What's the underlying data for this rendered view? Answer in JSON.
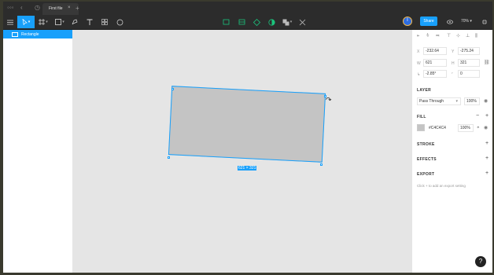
{
  "window": {
    "tab_title": "First file",
    "tab_close": "×",
    "new_tab": "+"
  },
  "toolbar": {
    "share_label": "Share",
    "zoom_label": "70%",
    "avatar_initial": "I"
  },
  "layers": {
    "items": [
      {
        "label": "Rectangle"
      }
    ]
  },
  "canvas": {
    "selection_size_label": "621 × 321"
  },
  "design": {
    "x": {
      "label": "X",
      "value": "-232.64"
    },
    "y": {
      "label": "Y",
      "value": "-275.24"
    },
    "w": {
      "label": "W",
      "value": "621"
    },
    "h": {
      "label": "H",
      "value": "321"
    },
    "rotation": {
      "label": "↳",
      "value": "-2.85°"
    },
    "radius": {
      "label": "⌜",
      "value": "0"
    }
  },
  "layer_section": {
    "title": "LAYER",
    "blend_mode": "Pass Through",
    "opacity": "100%"
  },
  "fill_section": {
    "title": "FILL",
    "color_hex": "#C4C4C4",
    "opacity": "100%",
    "swatch_color": "#C4C4C4"
  },
  "stroke_section": {
    "title": "STROKE"
  },
  "effects_section": {
    "title": "EFFECTS"
  },
  "export_section": {
    "title": "EXPORT",
    "hint": "Click + to add an export setting"
  },
  "help_label": "?",
  "colors": {
    "accent": "#18a0fb",
    "selection": "#18a0fb",
    "shape_fill": "#c4c4c4"
  }
}
